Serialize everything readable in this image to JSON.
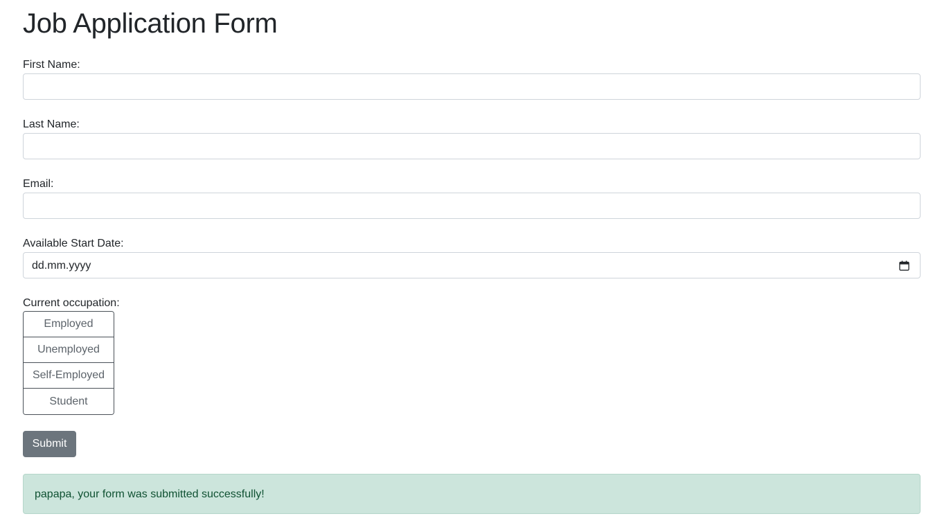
{
  "page": {
    "title": "Job Application Form"
  },
  "form": {
    "first_name": {
      "label": "First Name:",
      "value": "",
      "placeholder": ""
    },
    "last_name": {
      "label": "Last Name:",
      "value": "",
      "placeholder": ""
    },
    "email": {
      "label": "Email:",
      "value": "",
      "placeholder": ""
    },
    "start_date": {
      "label": "Available Start Date:",
      "display": "dd.mm.yyyy",
      "icon": "calendar-icon"
    },
    "occupation": {
      "label": "Current occupation:",
      "options": [
        "Employed",
        "Unemployed",
        "Self-Employed",
        "Student"
      ]
    },
    "submit_label": "Submit"
  },
  "alert": {
    "message": "papapa, your form was submitted successfully!",
    "background_color": "#cce5dc",
    "text_color": "#0f5132"
  },
  "colors": {
    "submit_button": "#6c757d",
    "input_border": "#ced4da"
  }
}
